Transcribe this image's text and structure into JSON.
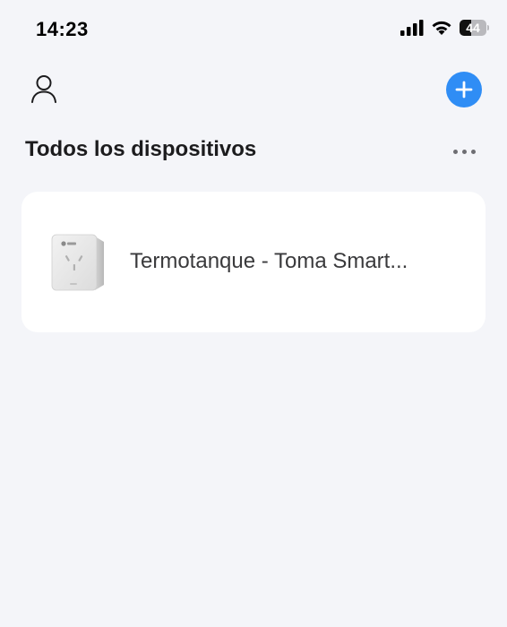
{
  "status_bar": {
    "time": "14:23",
    "battery_level": "44",
    "battery_percent": 44,
    "icons": [
      "signal-icon",
      "wifi-icon",
      "battery-icon"
    ]
  },
  "header": {
    "profile_icon": "person-icon",
    "add_icon": "plus-icon",
    "accent_color": "#2f8df5"
  },
  "section": {
    "title": "Todos los dispositivos",
    "more_icon": "ellipsis-icon"
  },
  "devices": [
    {
      "name": "Termotanque - Toma Smart...",
      "icon": "smart-plug-icon"
    }
  ]
}
